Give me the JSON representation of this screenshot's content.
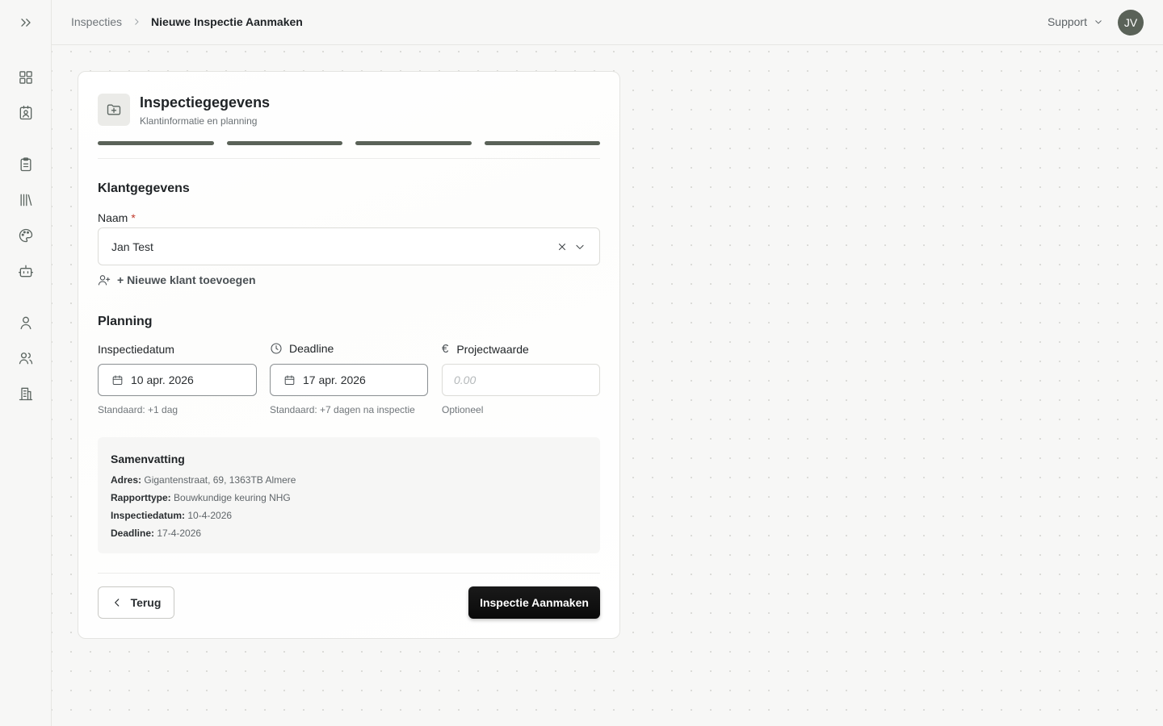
{
  "breadcrumb": {
    "parent": "Inspecties",
    "current": "Nieuwe Inspectie Aanmaken"
  },
  "header": {
    "support_label": "Support",
    "avatar_initials": "JV"
  },
  "card": {
    "title": "Inspectiegegevens",
    "subtitle": "Klantinformatie en planning",
    "progress_steps_completed": 4,
    "progress_steps_total": 4
  },
  "client": {
    "section_title": "Klantgegevens",
    "name_label": "Naam",
    "required_marker": "*",
    "name_value": "Jan Test",
    "add_client_label": "+ Nieuwe klant toevoegen"
  },
  "planning": {
    "section_title": "Planning",
    "inspection_date": {
      "label": "Inspectiedatum",
      "value": "10 apr. 2026",
      "hint": "Standaard: +1 dag"
    },
    "deadline": {
      "label": "Deadline",
      "value": "17 apr. 2026",
      "hint": "Standaard: +7 dagen na inspectie"
    },
    "project_value": {
      "label": "Projectwaarde",
      "placeholder": "0.00",
      "hint": "Optioneel",
      "currency_symbol": "€"
    }
  },
  "summary": {
    "title": "Samenvatting",
    "address_label": "Adres:",
    "address_value": "Gigantenstraat, 69, 1363TB Almere",
    "report_label": "Rapporttype:",
    "report_value": "Bouwkundige keuring NHG",
    "date_label": "Inspectiedatum:",
    "date_value": "10-4-2026",
    "deadline_label": "Deadline:",
    "deadline_value": "17-4-2026"
  },
  "actions": {
    "back_label": "Terug",
    "create_label": "Inspectie Aanmaken"
  },
  "sidebar": {
    "icons": [
      "expand-icon",
      "dashboard-icon",
      "contact-card-icon",
      "clipboard-icon",
      "library-icon",
      "palette-icon",
      "bot-icon",
      "user-icon",
      "users-icon",
      "building-icon"
    ]
  },
  "colors": {
    "accent": "#5a6258",
    "primary_button": "#0f0f0f",
    "required": "#c0392b"
  }
}
